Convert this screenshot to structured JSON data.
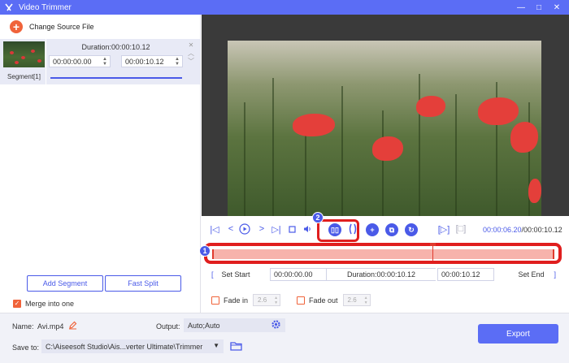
{
  "window": {
    "title": "Video Trimmer",
    "minimize": "—",
    "maximize": "□",
    "close": "✕"
  },
  "left": {
    "change_source": "Change Source File",
    "segment": {
      "label": "Segment[1]",
      "duration": "Duration:00:00:10.12",
      "start": "00:00:00.00",
      "end": "00:00:10.12"
    },
    "add_segment": "Add Segment",
    "fast_split": "Fast Split",
    "merge_label": "Merge into one",
    "merge_checked": true
  },
  "player": {
    "current_time": "00:00:06.20",
    "total_time": "/00:00:10.12"
  },
  "trim": {
    "set_start": "Set Start",
    "start_value": "00:00:00.00",
    "duration": "Duration:00:00:10.12",
    "end_value": "00:00:10.12",
    "set_end": "Set End"
  },
  "fade": {
    "fade_in_label": "Fade in",
    "fade_in_value": "2.6",
    "fade_out_label": "Fade out",
    "fade_out_value": "2.6"
  },
  "annotations": {
    "badge1": "1",
    "badge2": "2"
  },
  "bottom": {
    "name_label": "Name:",
    "name_value": "Avi.mp4",
    "output_label": "Output:",
    "output_value": "Auto;Auto",
    "save_label": "Save to:",
    "save_path": "C:\\Aiseesoft Studio\\Ais...verter Ultimate\\Trimmer",
    "export": "Export"
  },
  "colors": {
    "accent": "#5b6df5",
    "orange": "#f0633a",
    "highlight": "#e01e1e"
  }
}
